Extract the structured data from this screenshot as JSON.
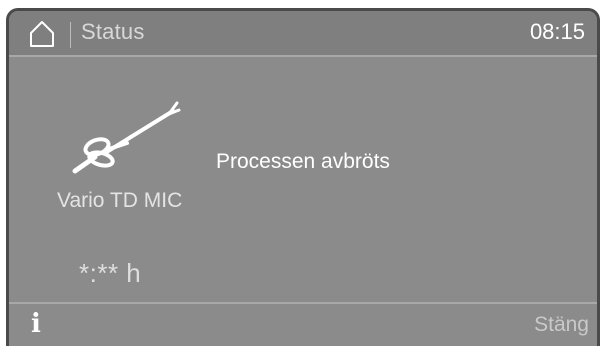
{
  "header": {
    "title": "Status",
    "time": "08:15",
    "home_icon": "home-icon"
  },
  "main": {
    "instrument_icon": "surgical-instrument-icon",
    "program_name": "Vario TD MIC",
    "message": "Processen avbröts",
    "remaining_time": "*:** h"
  },
  "footer": {
    "info_icon": "info-icon",
    "close_label": "Stäng"
  },
  "colors": {
    "screen_bg": "#8b8b8b",
    "header_bg": "#7f7f7f",
    "text_primary": "#ffffff",
    "text_muted": "#d8d8d8"
  }
}
